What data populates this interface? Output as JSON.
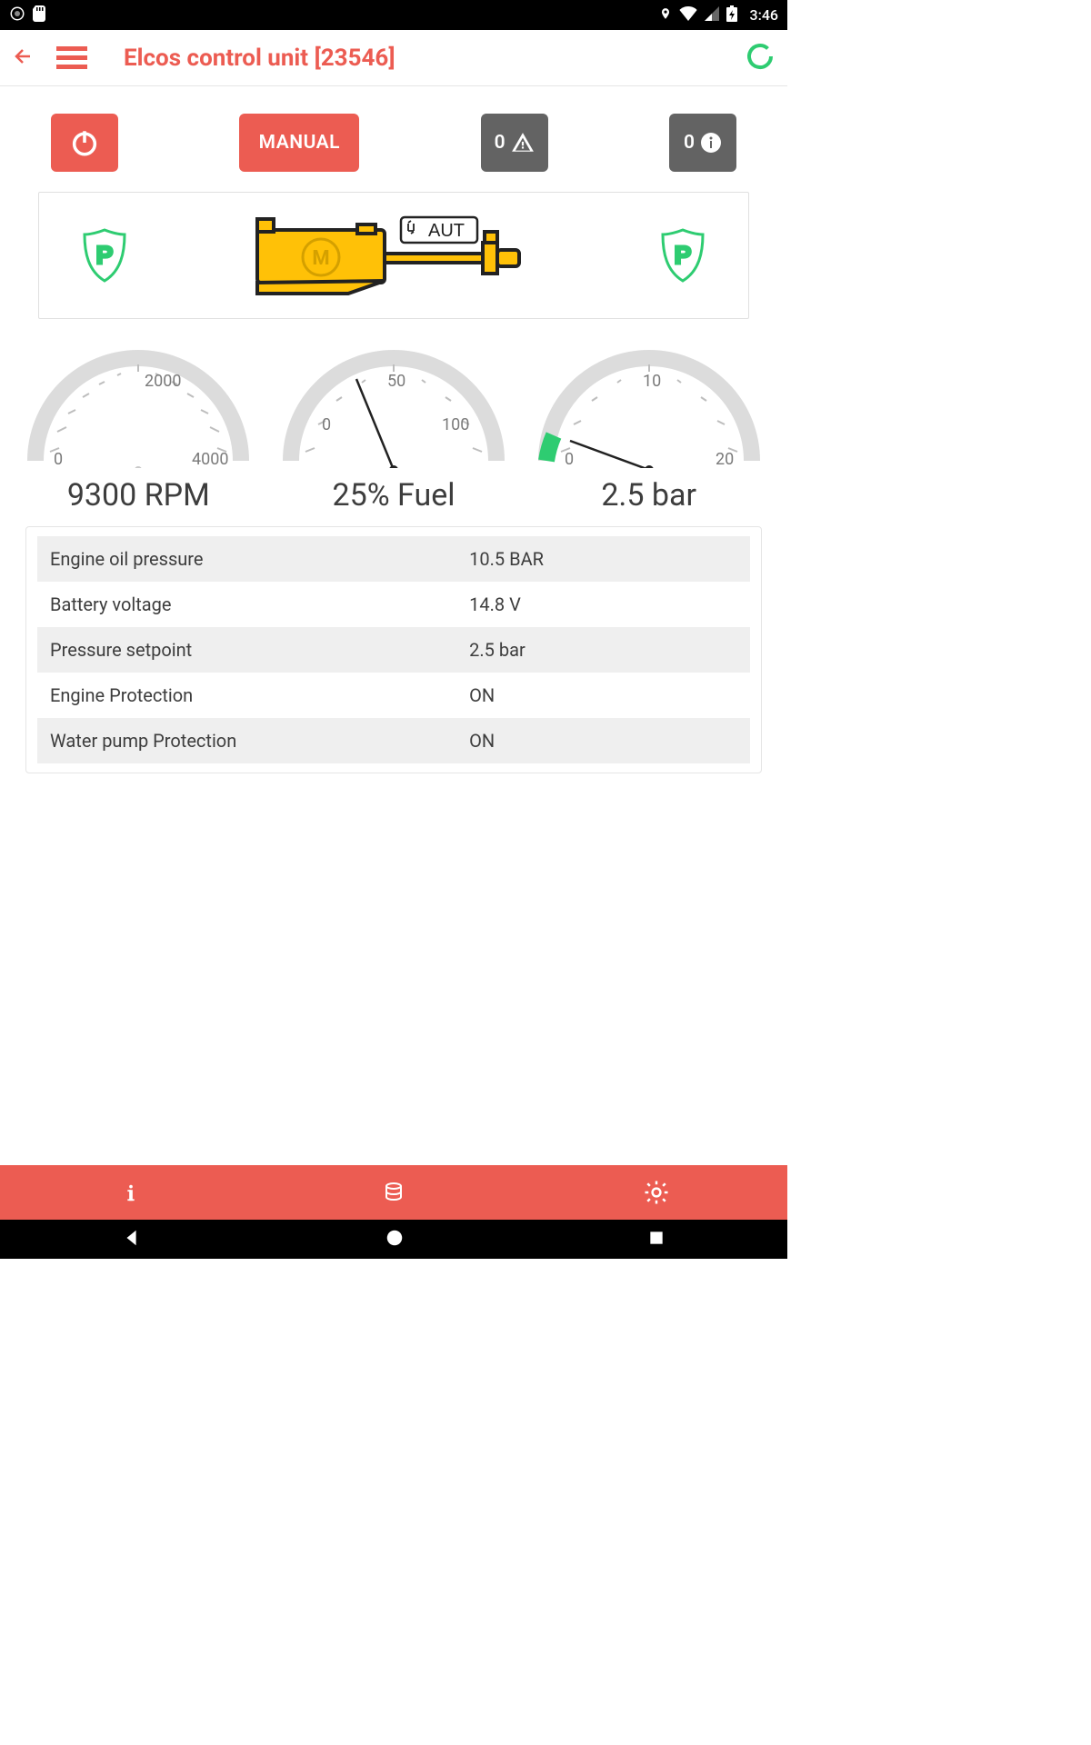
{
  "status": {
    "time": "3:46"
  },
  "header": {
    "title": "Elcos control unit [23546]"
  },
  "buttons": {
    "manual_label": "MANUAL",
    "alert_count": "0",
    "info_count": "0"
  },
  "device": {
    "mode_badge": "AUT"
  },
  "gauges": {
    "rpm": {
      "min": "0",
      "mid": "2000",
      "max": "4000",
      "label": "9300 RPM"
    },
    "fuel": {
      "min": "0",
      "mid": "50",
      "max": "100",
      "label": "25% Fuel"
    },
    "pressure": {
      "min": "0",
      "mid": "10",
      "max": "20",
      "label": "2.5 bar"
    }
  },
  "data_rows": [
    {
      "k": "Engine oil pressure",
      "v": "10.5 BAR"
    },
    {
      "k": "Battery voltage",
      "v": "14.8 V"
    },
    {
      "k": "Pressure setpoint",
      "v": "2.5 bar"
    },
    {
      "k": "Engine Protection",
      "v": "ON"
    },
    {
      "k": "Water pump Protection",
      "v": "ON"
    }
  ]
}
